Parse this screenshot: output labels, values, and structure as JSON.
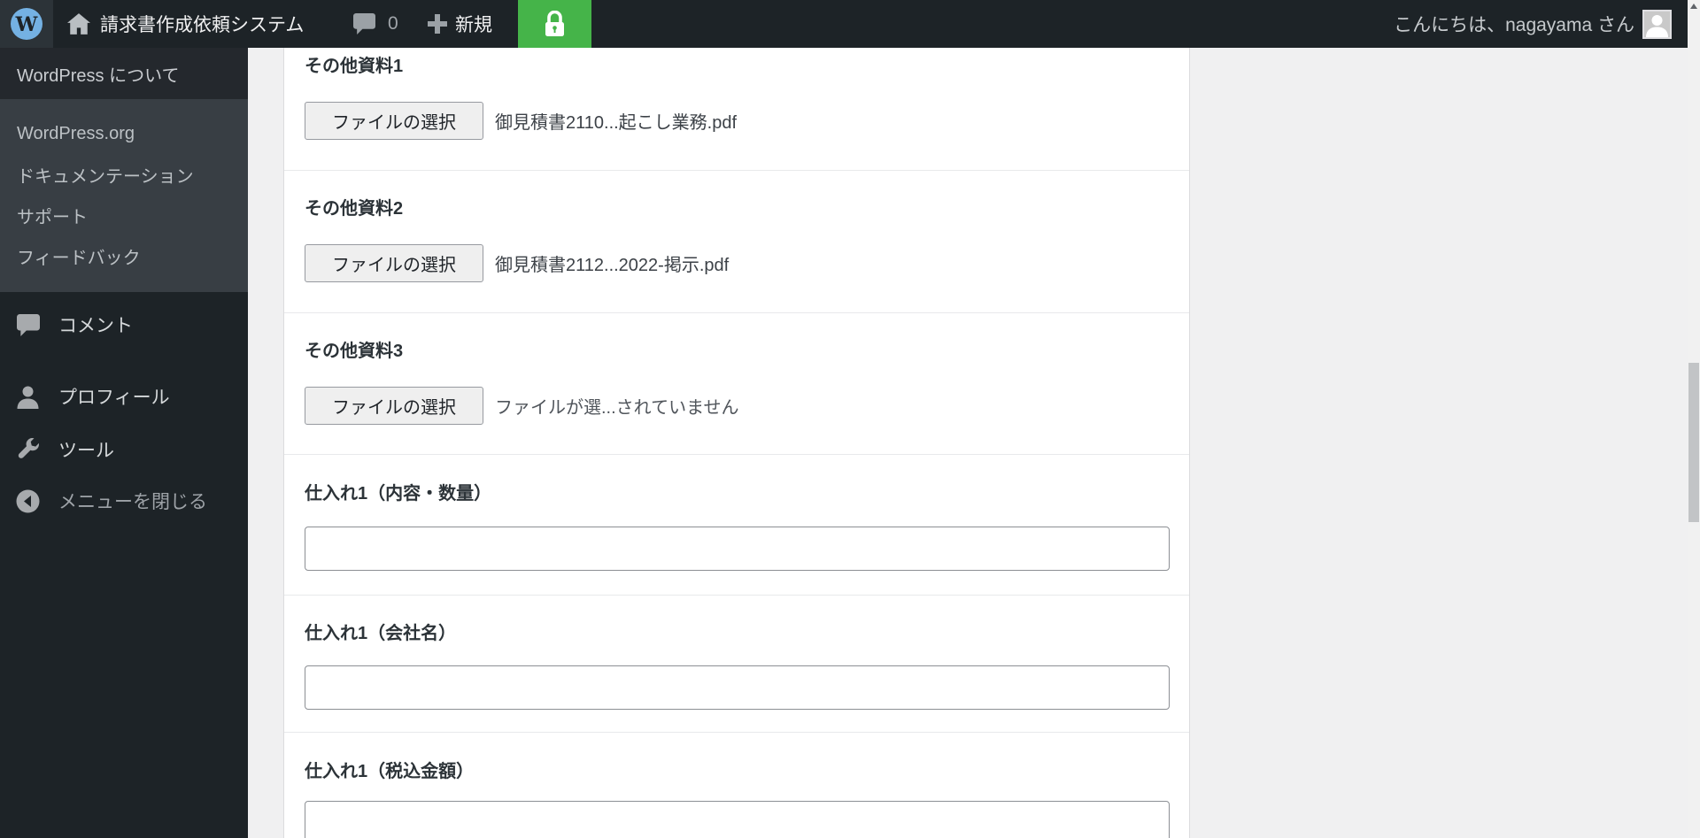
{
  "admin_bar": {
    "logo_letter": "W",
    "site_title": "請求書作成依頼システム",
    "comment_count": "0",
    "new_label": "新規",
    "howdy": "こんにちは、nagayama さん",
    "colors": {
      "bar_bg": "#1d2327",
      "lock_button_bg": "#45b449",
      "logo_blue": "#74b1e3"
    }
  },
  "wp_logo_menu": {
    "primary_label": "WordPress について",
    "secondary": [
      {
        "label": "WordPress.org"
      },
      {
        "label": "ドキュメンテーション"
      },
      {
        "label": "サポート"
      },
      {
        "label": "フィードバック"
      }
    ]
  },
  "sidebar": {
    "items": [
      {
        "label": "コメント",
        "icon": "comment-icon"
      },
      {
        "label": "プロフィール",
        "icon": "user-icon"
      },
      {
        "label": "ツール",
        "icon": "wrench-icon"
      },
      {
        "label": "メニューを閉じる",
        "icon": "collapse-arrow-icon"
      }
    ]
  },
  "form": {
    "rows": [
      {
        "label": "その他資料1",
        "type": "file",
        "button_label": "ファイルの選択",
        "file_text": "御見積書2110...起こし業務.pdf"
      },
      {
        "label": "その他資料2",
        "type": "file",
        "button_label": "ファイルの選択",
        "file_text": "御見積書2112...2022-掲示.pdf"
      },
      {
        "label": "その他資料3",
        "type": "file",
        "button_label": "ファイルの選択",
        "file_text": "ファイルが選...されていません"
      },
      {
        "label": "仕入れ1（内容・数量）",
        "type": "text",
        "value": ""
      },
      {
        "label": "仕入れ1（会社名）",
        "type": "text",
        "value": ""
      },
      {
        "label": "仕入れ1（税込金額）",
        "type": "text",
        "value": ""
      }
    ]
  }
}
